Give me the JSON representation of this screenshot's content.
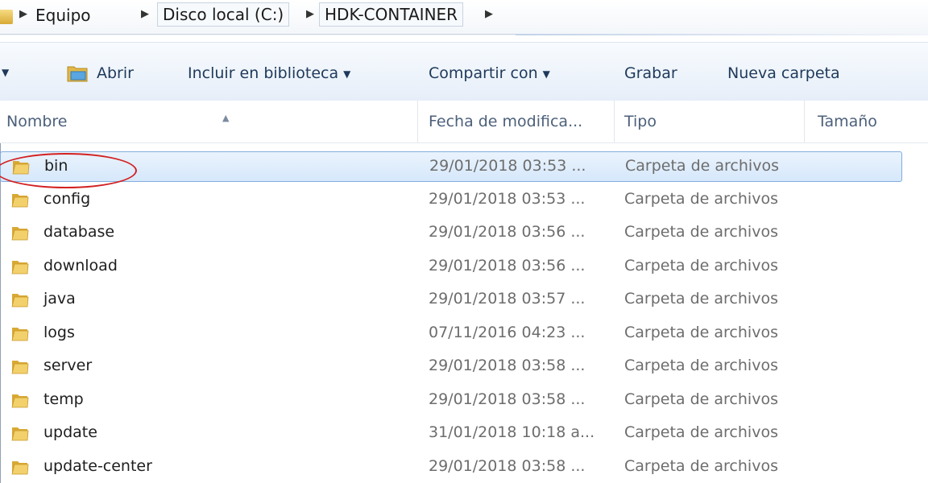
{
  "breadcrumb": {
    "items": [
      "Equipo",
      "Disco local (C:)",
      "HDK-CONTAINER"
    ],
    "separator": "▶"
  },
  "toolbar": {
    "open_label": "Abrir",
    "include_label": "Incluir en biblioteca",
    "share_label": "Compartir con",
    "burn_label": "Grabar",
    "new_folder_label": "Nueva carpeta",
    "dropdown_glyph": "▼"
  },
  "columns": {
    "name": "Nombre",
    "date": "Fecha de modifica...",
    "type": "Tipo",
    "size": "Tamaño"
  },
  "files": [
    {
      "name": "bin",
      "date": "29/01/2018 03:53 ...",
      "type": "Carpeta de archivos",
      "selected": true
    },
    {
      "name": "config",
      "date": "29/01/2018 03:53 ...",
      "type": "Carpeta de archivos"
    },
    {
      "name": "database",
      "date": "29/01/2018 03:56 ...",
      "type": "Carpeta de archivos"
    },
    {
      "name": "download",
      "date": "29/01/2018 03:56 ...",
      "type": "Carpeta de archivos"
    },
    {
      "name": "java",
      "date": "29/01/2018 03:57 ...",
      "type": "Carpeta de archivos"
    },
    {
      "name": "logs",
      "date": "07/11/2016 04:23 ...",
      "type": "Carpeta de archivos"
    },
    {
      "name": "server",
      "date": "29/01/2018 03:58 ...",
      "type": "Carpeta de archivos"
    },
    {
      "name": "temp",
      "date": "29/01/2018 03:58 ...",
      "type": "Carpeta de archivos"
    },
    {
      "name": "update",
      "date": "31/01/2018 10:18 a...",
      "type": "Carpeta de archivos"
    },
    {
      "name": "update-center",
      "date": "29/01/2018 03:58 ...",
      "type": "Carpeta de archivos"
    }
  ],
  "colors": {
    "selection_border": "#84acdd",
    "annotation_red": "#d32020",
    "folder_yellow": "#e8c35a"
  }
}
